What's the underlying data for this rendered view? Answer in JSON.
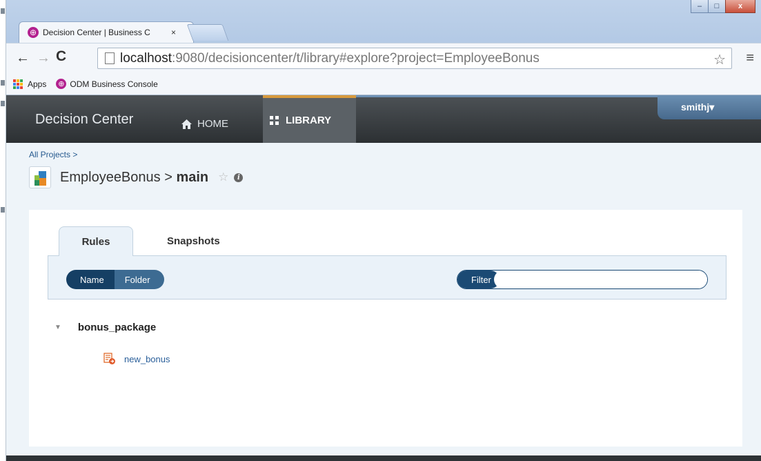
{
  "browser": {
    "tab_title": "Decision Center | Business C",
    "tab_close": "×",
    "url_host": "localhost",
    "url_path": ":9080/decisioncenter/t/library#explore?project=EmployeeBonus",
    "bookmarks": [
      "Apps",
      "ODM Business Console"
    ],
    "window_buttons": {
      "minimize": "–",
      "maximize": "□",
      "close": "x"
    }
  },
  "header": {
    "brand": "Decision Center",
    "nav_home": "HOME",
    "nav_library": "LIBRARY",
    "user": "smithj▾",
    "accent_color": "#d89a3d"
  },
  "breadcrumb": "All Projects >",
  "project": {
    "name": "EmployeeBonus > ",
    "branch": "main"
  },
  "tabs": {
    "rules": "Rules",
    "snapshots": "Snapshots"
  },
  "view_toggle": {
    "name": "Name",
    "folder": "Folder",
    "selected": "Name"
  },
  "filter": {
    "label": "Filter",
    "value": ""
  },
  "tree": {
    "package": "bonus_package",
    "items": [
      "new_bonus"
    ]
  }
}
